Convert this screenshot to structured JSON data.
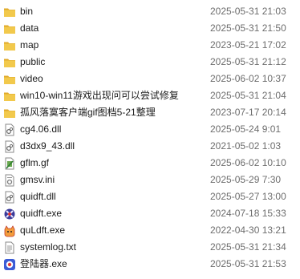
{
  "files": [
    {
      "name": "bin",
      "date": "2025-05-31 21:03",
      "icon": "folder-icon"
    },
    {
      "name": "data",
      "date": "2025-05-31 21:50",
      "icon": "folder-icon"
    },
    {
      "name": "map",
      "date": "2023-05-21 17:02",
      "icon": "folder-icon"
    },
    {
      "name": "public",
      "date": "2025-05-31 21:12",
      "icon": "folder-icon"
    },
    {
      "name": "video",
      "date": "2025-06-02 10:37",
      "icon": "folder-icon"
    },
    {
      "name": "win10-win11游戏出现问可以尝试修复",
      "date": "2025-05-31 21:04",
      "icon": "folder-icon"
    },
    {
      "name": "孤风落寞客户端gif图档5-21整理",
      "date": "2023-07-17 20:14",
      "icon": "folder-icon"
    },
    {
      "name": "cg4.06.dll",
      "date": "2025-05-24 9:01",
      "icon": "dll-file-icon"
    },
    {
      "name": "d3dx9_43.dll",
      "date": "2021-05-02 1:03",
      "icon": "dll-file-icon"
    },
    {
      "name": "gflm.gf",
      "date": "2025-06-02 10:10",
      "icon": "gf-file-icon"
    },
    {
      "name": "gmsv.ini",
      "date": "2025-05-29 7:30",
      "icon": "ini-file-icon"
    },
    {
      "name": "quidft.dll",
      "date": "2025-05-27 13:00",
      "icon": "dll-file-icon"
    },
    {
      "name": "quidft.exe",
      "date": "2024-07-18 15:33",
      "icon": "crossgate-app-icon"
    },
    {
      "name": "quLdft.exe",
      "date": "2022-04-30 13:21",
      "icon": "cat-app-icon"
    },
    {
      "name": "systemlog.txt",
      "date": "2025-05-31 21:34",
      "icon": "txt-file-icon"
    },
    {
      "name": "登陆器.exe",
      "date": "2025-05-31 21:53",
      "icon": "launcher-app-icon"
    }
  ],
  "colors": {
    "folder": "#f2c94c",
    "folder_dark": "#e0a92a",
    "date_text": "#6d6d6d"
  }
}
